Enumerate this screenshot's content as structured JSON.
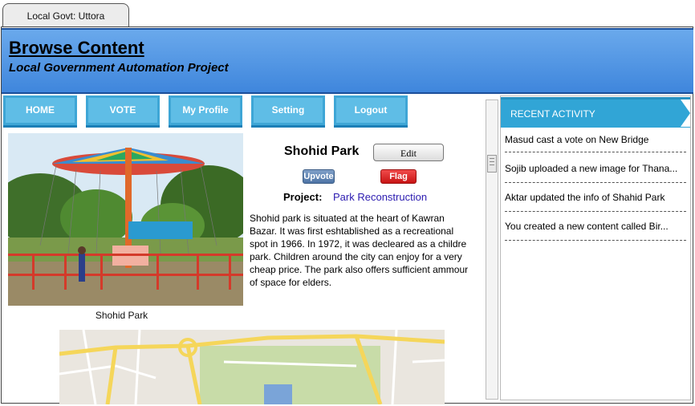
{
  "window": {
    "tab_title": "Local Govt: Uttora"
  },
  "header": {
    "title": "Browse Content",
    "subtitle": "Local Government Automation Project"
  },
  "nav": {
    "items": [
      {
        "label": "HOME"
      },
      {
        "label": "VOTE"
      },
      {
        "label": "My Profile"
      },
      {
        "label": "Setting"
      },
      {
        "label": "Logout"
      }
    ]
  },
  "content": {
    "image_caption": "Shohid Park",
    "name": "Shohid Park",
    "edit_label": "Edit",
    "upvote_label": "Upvote",
    "flag_label": "Flag",
    "project_label": "Project:",
    "project_name": "Park Reconstruction",
    "description_lines": [
      "Shohid park is situated at the heart of Kawran",
      "Bazar. It was first eshtablished as a recreational",
      "spot in 1966. In 1972, it was decleared as a childre",
      "park. Children around the city can enjoy for a very",
      "cheap price. The park also offers sufficient ammour",
      "of space for elders."
    ]
  },
  "activity": {
    "title": "RECENT ACTIVITY",
    "items": [
      "Masud cast a vote on New Bridge",
      "Sojib uploaded a new image for Thana...",
      "Aktar updated the info of Shahid Park",
      "You created a new content called Bir..."
    ]
  },
  "colors": {
    "header_blue": "#3f86dc",
    "nav_blue": "#5fbde6",
    "activity_blue": "#31a5d6",
    "flag_red": "#c81414",
    "link_purple": "#2b1bb0"
  }
}
